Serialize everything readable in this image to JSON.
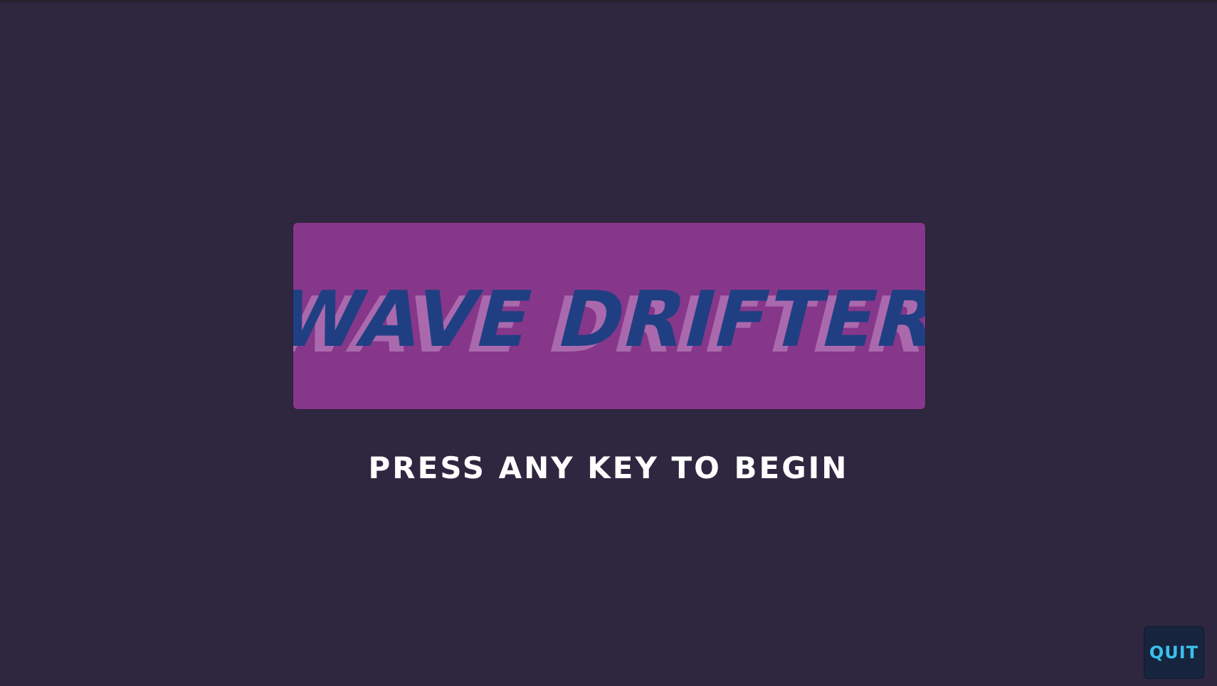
{
  "game": {
    "title": "WAVE DRIFTER",
    "prompt": "PRESS ANY KEY TO BEGIN",
    "quit_label": "QUIT"
  },
  "colors": {
    "background": "#2f2640",
    "banner": "#86378a",
    "title_main": "#203f83",
    "title_shadow": "#b272b4",
    "prompt_text": "#ffffff",
    "quit_bg": "#16243e",
    "quit_text": "#39c0ea"
  }
}
